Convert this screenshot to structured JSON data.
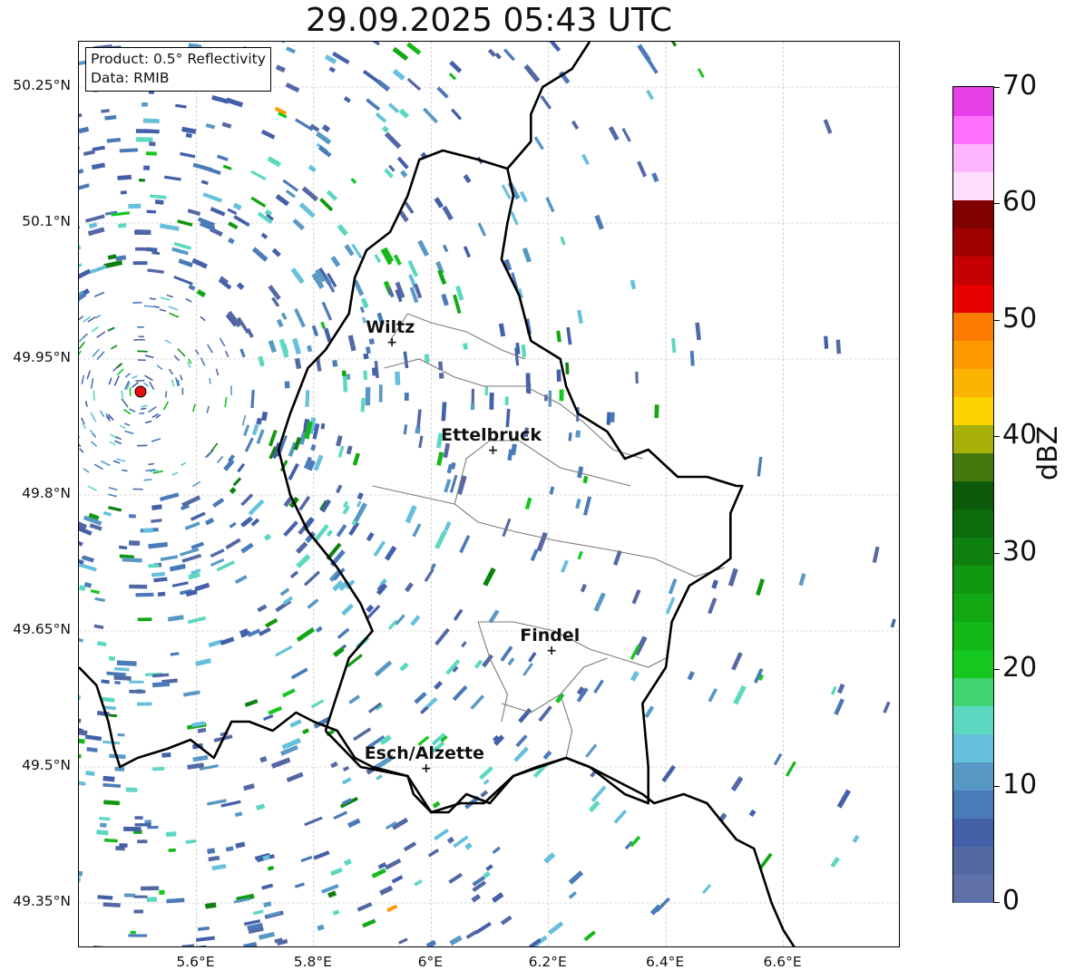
{
  "title": "29.09.2025 05:43 UTC",
  "info": {
    "product": "Product: 0.5° Reflectivity",
    "data_source": "Data: RMIB"
  },
  "map": {
    "lon_range": [
      5.4,
      6.8
    ],
    "lat_range": [
      49.3,
      50.3
    ],
    "lat_ticks": [
      {
        "value": 50.25,
        "label": "50.25°N"
      },
      {
        "value": 50.1,
        "label": "50.1°N"
      },
      {
        "value": 49.95,
        "label": "49.95°N"
      },
      {
        "value": 49.8,
        "label": "49.8°N"
      },
      {
        "value": 49.65,
        "label": "49.65°N"
      },
      {
        "value": 49.5,
        "label": "49.5°N"
      },
      {
        "value": 49.35,
        "label": "49.35°N"
      }
    ],
    "lon_ticks": [
      {
        "value": 5.6,
        "label": "5.6°E"
      },
      {
        "value": 5.8,
        "label": "5.8°E"
      },
      {
        "value": 6.0,
        "label": "6°E"
      },
      {
        "value": 6.2,
        "label": "6.2°E"
      },
      {
        "value": 6.4,
        "label": "6.4°E"
      },
      {
        "value": 6.6,
        "label": "6.6°E"
      }
    ],
    "radar_site": {
      "lon": 5.505,
      "lat": 49.914,
      "color": "#e81010"
    },
    "cities": [
      {
        "name": "Wiltz",
        "lon": 5.932,
        "lat": 49.967
      },
      {
        "name": "Ettelbruck",
        "lon": 6.104,
        "lat": 49.848
      },
      {
        "name": "Findel",
        "lon": 6.204,
        "lat": 49.627
      },
      {
        "name": "Esch/Alzette",
        "lon": 5.99,
        "lat": 49.497
      }
    ],
    "country_border": [
      [
        5.4,
        49.61
      ],
      [
        5.43,
        49.59
      ],
      [
        5.45,
        49.55
      ],
      [
        5.46,
        49.52
      ],
      [
        5.47,
        49.5
      ],
      [
        5.5,
        49.51
      ],
      [
        5.55,
        49.52
      ],
      [
        5.59,
        49.53
      ],
      [
        5.61,
        49.52
      ],
      [
        5.63,
        49.51
      ],
      [
        5.66,
        49.55
      ],
      [
        5.69,
        49.55
      ],
      [
        5.73,
        49.54
      ],
      [
        5.77,
        49.56
      ],
      [
        5.8,
        49.55
      ],
      [
        5.84,
        49.54
      ],
      [
        5.87,
        49.51
      ],
      [
        5.9,
        49.5
      ],
      [
        5.96,
        49.49
      ],
      [
        5.97,
        49.47
      ],
      [
        6.0,
        49.45
      ],
      [
        6.03,
        49.45
      ],
      [
        6.06,
        49.47
      ],
      [
        6.1,
        49.46
      ],
      [
        6.14,
        49.49
      ],
      [
        6.18,
        49.5
      ],
      [
        6.23,
        49.51
      ],
      [
        6.27,
        49.5
      ],
      [
        6.3,
        49.49
      ],
      [
        6.33,
        49.48
      ],
      [
        6.36,
        49.47
      ],
      [
        6.38,
        49.46
      ],
      [
        6.43,
        49.47
      ],
      [
        6.47,
        49.46
      ],
      [
        6.52,
        49.42
      ],
      [
        6.55,
        49.41
      ],
      [
        6.56,
        49.39
      ],
      [
        6.58,
        49.35
      ],
      [
        6.6,
        49.32
      ],
      [
        6.62,
        49.3
      ]
    ],
    "lux_border": [
      [
        5.82,
        49.54
      ],
      [
        5.88,
        49.5
      ],
      [
        5.96,
        49.49
      ],
      [
        6.0,
        49.45
      ],
      [
        6.05,
        49.46
      ],
      [
        6.09,
        49.46
      ],
      [
        6.14,
        49.49
      ],
      [
        6.23,
        49.51
      ],
      [
        6.27,
        49.5
      ],
      [
        6.33,
        49.47
      ],
      [
        6.37,
        49.46
      ],
      [
        6.37,
        49.5
      ],
      [
        6.36,
        49.57
      ],
      [
        6.4,
        49.61
      ],
      [
        6.41,
        49.66
      ],
      [
        6.44,
        49.7
      ],
      [
        6.49,
        49.72
      ],
      [
        6.51,
        49.73
      ],
      [
        6.51,
        49.78
      ],
      [
        6.53,
        49.81
      ],
      [
        6.52,
        49.81
      ],
      [
        6.47,
        49.82
      ],
      [
        6.42,
        49.82
      ],
      [
        6.37,
        49.85
      ],
      [
        6.33,
        49.84
      ],
      [
        6.3,
        49.87
      ],
      [
        6.25,
        49.89
      ],
      [
        6.23,
        49.92
      ],
      [
        6.22,
        49.95
      ],
      [
        6.17,
        49.97
      ],
      [
        6.15,
        50.02
      ],
      [
        6.12,
        50.06
      ],
      [
        6.13,
        50.1
      ],
      [
        6.14,
        50.13
      ],
      [
        6.13,
        50.16
      ],
      [
        6.08,
        50.17
      ],
      [
        6.02,
        50.18
      ],
      [
        5.98,
        50.17
      ],
      [
        5.96,
        50.13
      ],
      [
        5.93,
        50.09
      ],
      [
        5.89,
        50.07
      ],
      [
        5.87,
        50.04
      ],
      [
        5.86,
        50.0
      ],
      [
        5.82,
        49.96
      ],
      [
        5.79,
        49.94
      ],
      [
        5.76,
        49.89
      ],
      [
        5.74,
        49.85
      ],
      [
        5.76,
        49.8
      ],
      [
        5.79,
        49.76
      ],
      [
        5.84,
        49.72
      ],
      [
        5.88,
        49.68
      ],
      [
        5.9,
        49.65
      ],
      [
        5.86,
        49.62
      ],
      [
        5.84,
        49.58
      ],
      [
        5.82,
        49.54
      ]
    ],
    "germany_border_north": [
      [
        6.13,
        50.16
      ],
      [
        6.17,
        50.19
      ],
      [
        6.17,
        50.22
      ],
      [
        6.19,
        50.25
      ],
      [
        6.24,
        50.27
      ],
      [
        6.27,
        50.3
      ]
    ],
    "admin_lines": [
      [
        [
          5.92,
          49.94
        ],
        [
          5.98,
          49.95
        ],
        [
          6.04,
          49.93
        ],
        [
          6.09,
          49.92
        ],
        [
          6.16,
          49.92
        ],
        [
          6.22,
          49.9
        ],
        [
          6.26,
          49.88
        ],
        [
          6.31,
          49.85
        ],
        [
          6.36,
          49.84
        ]
      ],
      [
        [
          5.93,
          49.97
        ],
        [
          5.96,
          50.0
        ],
        [
          6.0,
          49.99
        ],
        [
          6.06,
          49.98
        ],
        [
          6.12,
          49.96
        ],
        [
          6.16,
          49.95
        ]
      ],
      [
        [
          5.9,
          49.81
        ],
        [
          5.97,
          49.8
        ],
        [
          6.04,
          49.79
        ],
        [
          6.08,
          49.77
        ],
        [
          6.14,
          49.76
        ],
        [
          6.21,
          49.75
        ],
        [
          6.3,
          49.74
        ],
        [
          6.38,
          49.73
        ],
        [
          6.45,
          49.71
        ],
        [
          6.5,
          49.72
        ]
      ],
      [
        [
          6.04,
          49.79
        ],
        [
          6.06,
          49.84
        ],
        [
          6.1,
          49.86
        ],
        [
          6.15,
          49.86
        ],
        [
          6.22,
          49.83
        ],
        [
          6.28,
          49.82
        ],
        [
          6.34,
          49.81
        ]
      ],
      [
        [
          6.08,
          49.66
        ],
        [
          6.14,
          49.66
        ],
        [
          6.21,
          49.65
        ],
        [
          6.27,
          49.63
        ],
        [
          6.32,
          49.62
        ],
        [
          6.37,
          49.61
        ],
        [
          6.4,
          49.62
        ]
      ],
      [
        [
          6.12,
          49.57
        ],
        [
          6.17,
          49.56
        ],
        [
          6.22,
          49.58
        ],
        [
          6.26,
          49.61
        ],
        [
          6.3,
          49.62
        ]
      ],
      [
        [
          6.08,
          49.66
        ],
        [
          6.1,
          49.62
        ],
        [
          6.13,
          49.58
        ],
        [
          6.12,
          49.55
        ]
      ],
      [
        [
          6.22,
          49.58
        ],
        [
          6.24,
          49.54
        ],
        [
          6.23,
          49.51
        ]
      ]
    ]
  },
  "colorbar": {
    "unit": "dBZ",
    "min": 0,
    "max": 70,
    "step": 2.5,
    "colors": [
      "#6070a8",
      "#5468a4",
      "#4460a8",
      "#4a7ab8",
      "#5898c4",
      "#66c0dc",
      "#5cd8c0",
      "#40d470",
      "#14c820",
      "#14b818",
      "#12a814",
      "#109810",
      "#0e8010",
      "#0b6c0c",
      "#0a5a0a",
      "#467810",
      "#a8b00a",
      "#fcd400",
      "#fcb400",
      "#fc9a00",
      "#fc7c00",
      "#e80000",
      "#c40000",
      "#a00000",
      "#800000",
      "#ffddff",
      "#ffb4ff",
      "#ff70ff",
      "#e840e8"
    ],
    "ticks": [
      {
        "value": 0,
        "label": "0"
      },
      {
        "value": 10,
        "label": "10"
      },
      {
        "value": 20,
        "label": "20"
      },
      {
        "value": 30,
        "label": "30"
      },
      {
        "value": 40,
        "label": "40"
      },
      {
        "value": 50,
        "label": "50"
      },
      {
        "value": 60,
        "label": "60"
      },
      {
        "value": 70,
        "label": "70"
      }
    ]
  }
}
